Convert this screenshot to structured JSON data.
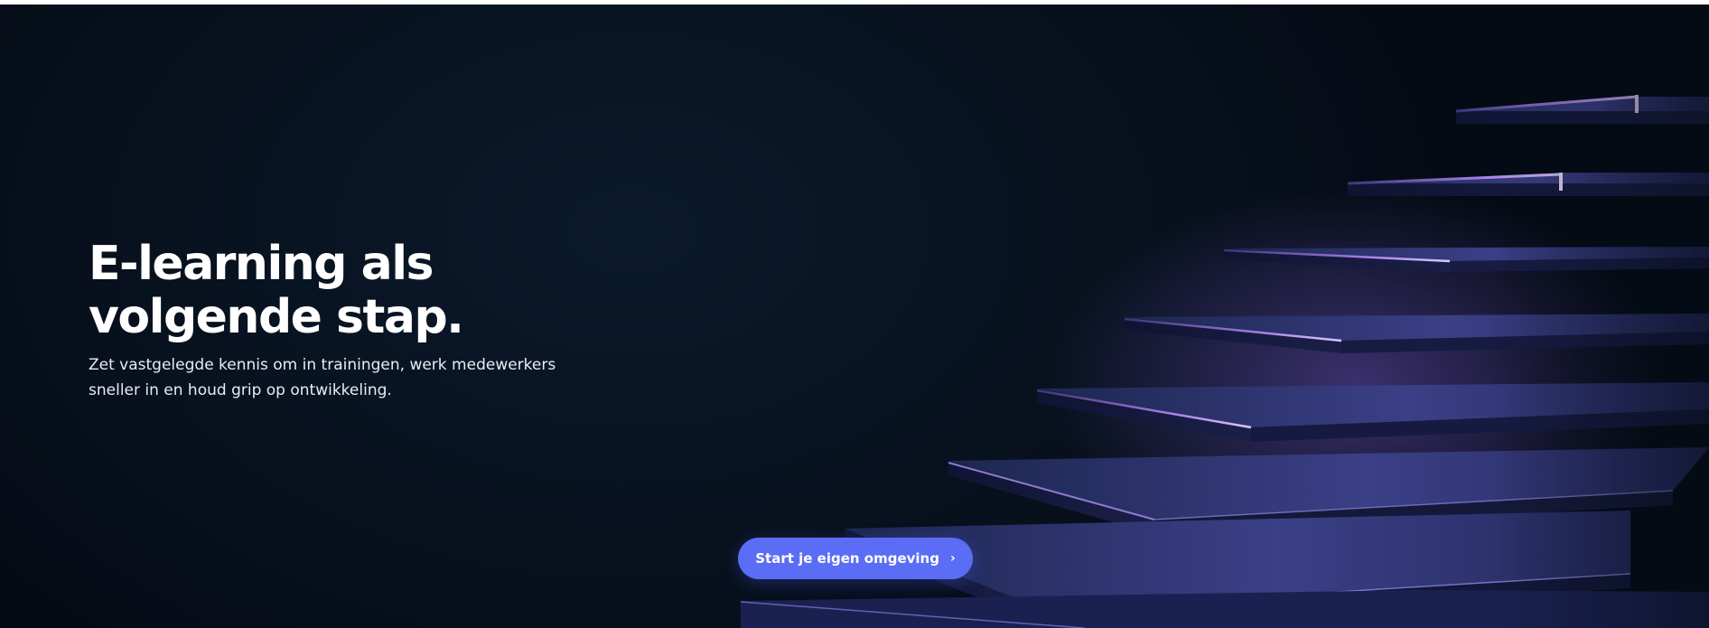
{
  "hero": {
    "headline_line1": "E-learning als",
    "headline_line2": "volgende stap.",
    "subtitle_line1": "Zet vastgelegde kennis om in trainingen, werk medewerkers",
    "subtitle_line2": "sneller in en houd grip op ontwikkeling.",
    "cta_label": "Start je eigen omgeving",
    "cta_icon": "chevron-right-icon"
  },
  "colors": {
    "background": "#08121f",
    "accent": "#5b6cf5",
    "step_glow": "#b98cf0"
  }
}
